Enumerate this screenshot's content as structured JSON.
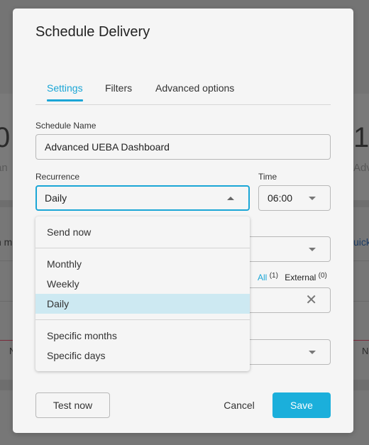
{
  "background": {
    "left_stat_value": "0",
    "left_stat_label": "an",
    "right_stat_value": "1",
    "right_stat_label": "Adv",
    "left_fragment": "n m",
    "right_link": "uick",
    "left_col": "N",
    "right_col": "N"
  },
  "modal": {
    "title": "Schedule Delivery",
    "tabs": [
      {
        "label": "Settings",
        "active": true
      },
      {
        "label": "Filters",
        "active": false
      },
      {
        "label": "Advanced options",
        "active": false
      }
    ],
    "schedule_name": {
      "label": "Schedule Name",
      "value": "Advanced UEBA Dashboard"
    },
    "recurrence": {
      "label": "Recurrence",
      "value": "Daily",
      "options": {
        "group1": [
          "Send now"
        ],
        "group2": [
          "Monthly",
          "Weekly",
          "Daily"
        ],
        "group3": [
          "Specific months",
          "Specific days"
        ]
      },
      "selected": "Daily"
    },
    "time": {
      "label": "Time",
      "value": "06:00"
    },
    "recipients": {
      "all_label": "All",
      "all_count": "(1)",
      "external_label": "External",
      "external_count": "(0)"
    },
    "footer": {
      "test_now": "Test now",
      "cancel": "Cancel",
      "save": "Save"
    }
  },
  "colors": {
    "accent": "#1ba6d6",
    "primary_button": "#1bafdb",
    "selected_option": "#cde9f2",
    "overlay": "#777777",
    "modal_bg": "#f5f5f5"
  }
}
